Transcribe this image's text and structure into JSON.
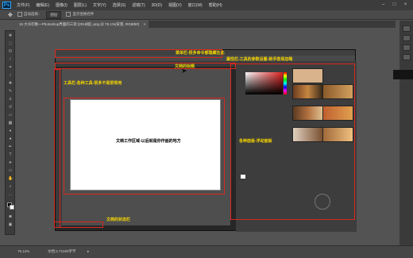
{
  "app": {
    "logo": "Ps"
  },
  "menu": [
    "文件(F)",
    "编辑(E)",
    "图像(I)",
    "图层(L)",
    "文字(Y)",
    "选择(S)",
    "滤镜(T)",
    "3D(D)",
    "视图(V)",
    "窗口(W)",
    "帮助(H)"
  ],
  "window_controls": {
    "minimize": "–",
    "maximize": "□",
    "close": "×"
  },
  "options_bar": {
    "auto_select": "自动选择：",
    "auto_select_value": "图层",
    "transform_controls": "显示变换控件"
  },
  "document_tab": {
    "title": "15 大众印象一Photoshop界面的三装 [2018版] .png @ 75.1%(背景, RGB/8#)",
    "close": "×"
  },
  "annotations": {
    "menubar": "菜单栏-很多命令都隐藏在此",
    "properties": "属性栏-工具的参数设置-新手容易忽略",
    "document_tab": "文档的标题",
    "toolbar": "工具栏-各种工具-很多不是很常用",
    "panels": "各种面板-浮动面板",
    "canvas": "文档工作区域-以后就是你作画的地方",
    "statusbar": "文档的状态栏"
  },
  "status_bar": {
    "zoom": "75.12%",
    "doc_size": "文档:3.71M/0字节"
  },
  "colors": {
    "accent_red": "#d8281e",
    "label_yellow": "#f5d400",
    "chrome_dark": "#3c3c3c",
    "workspace": "#535353"
  }
}
